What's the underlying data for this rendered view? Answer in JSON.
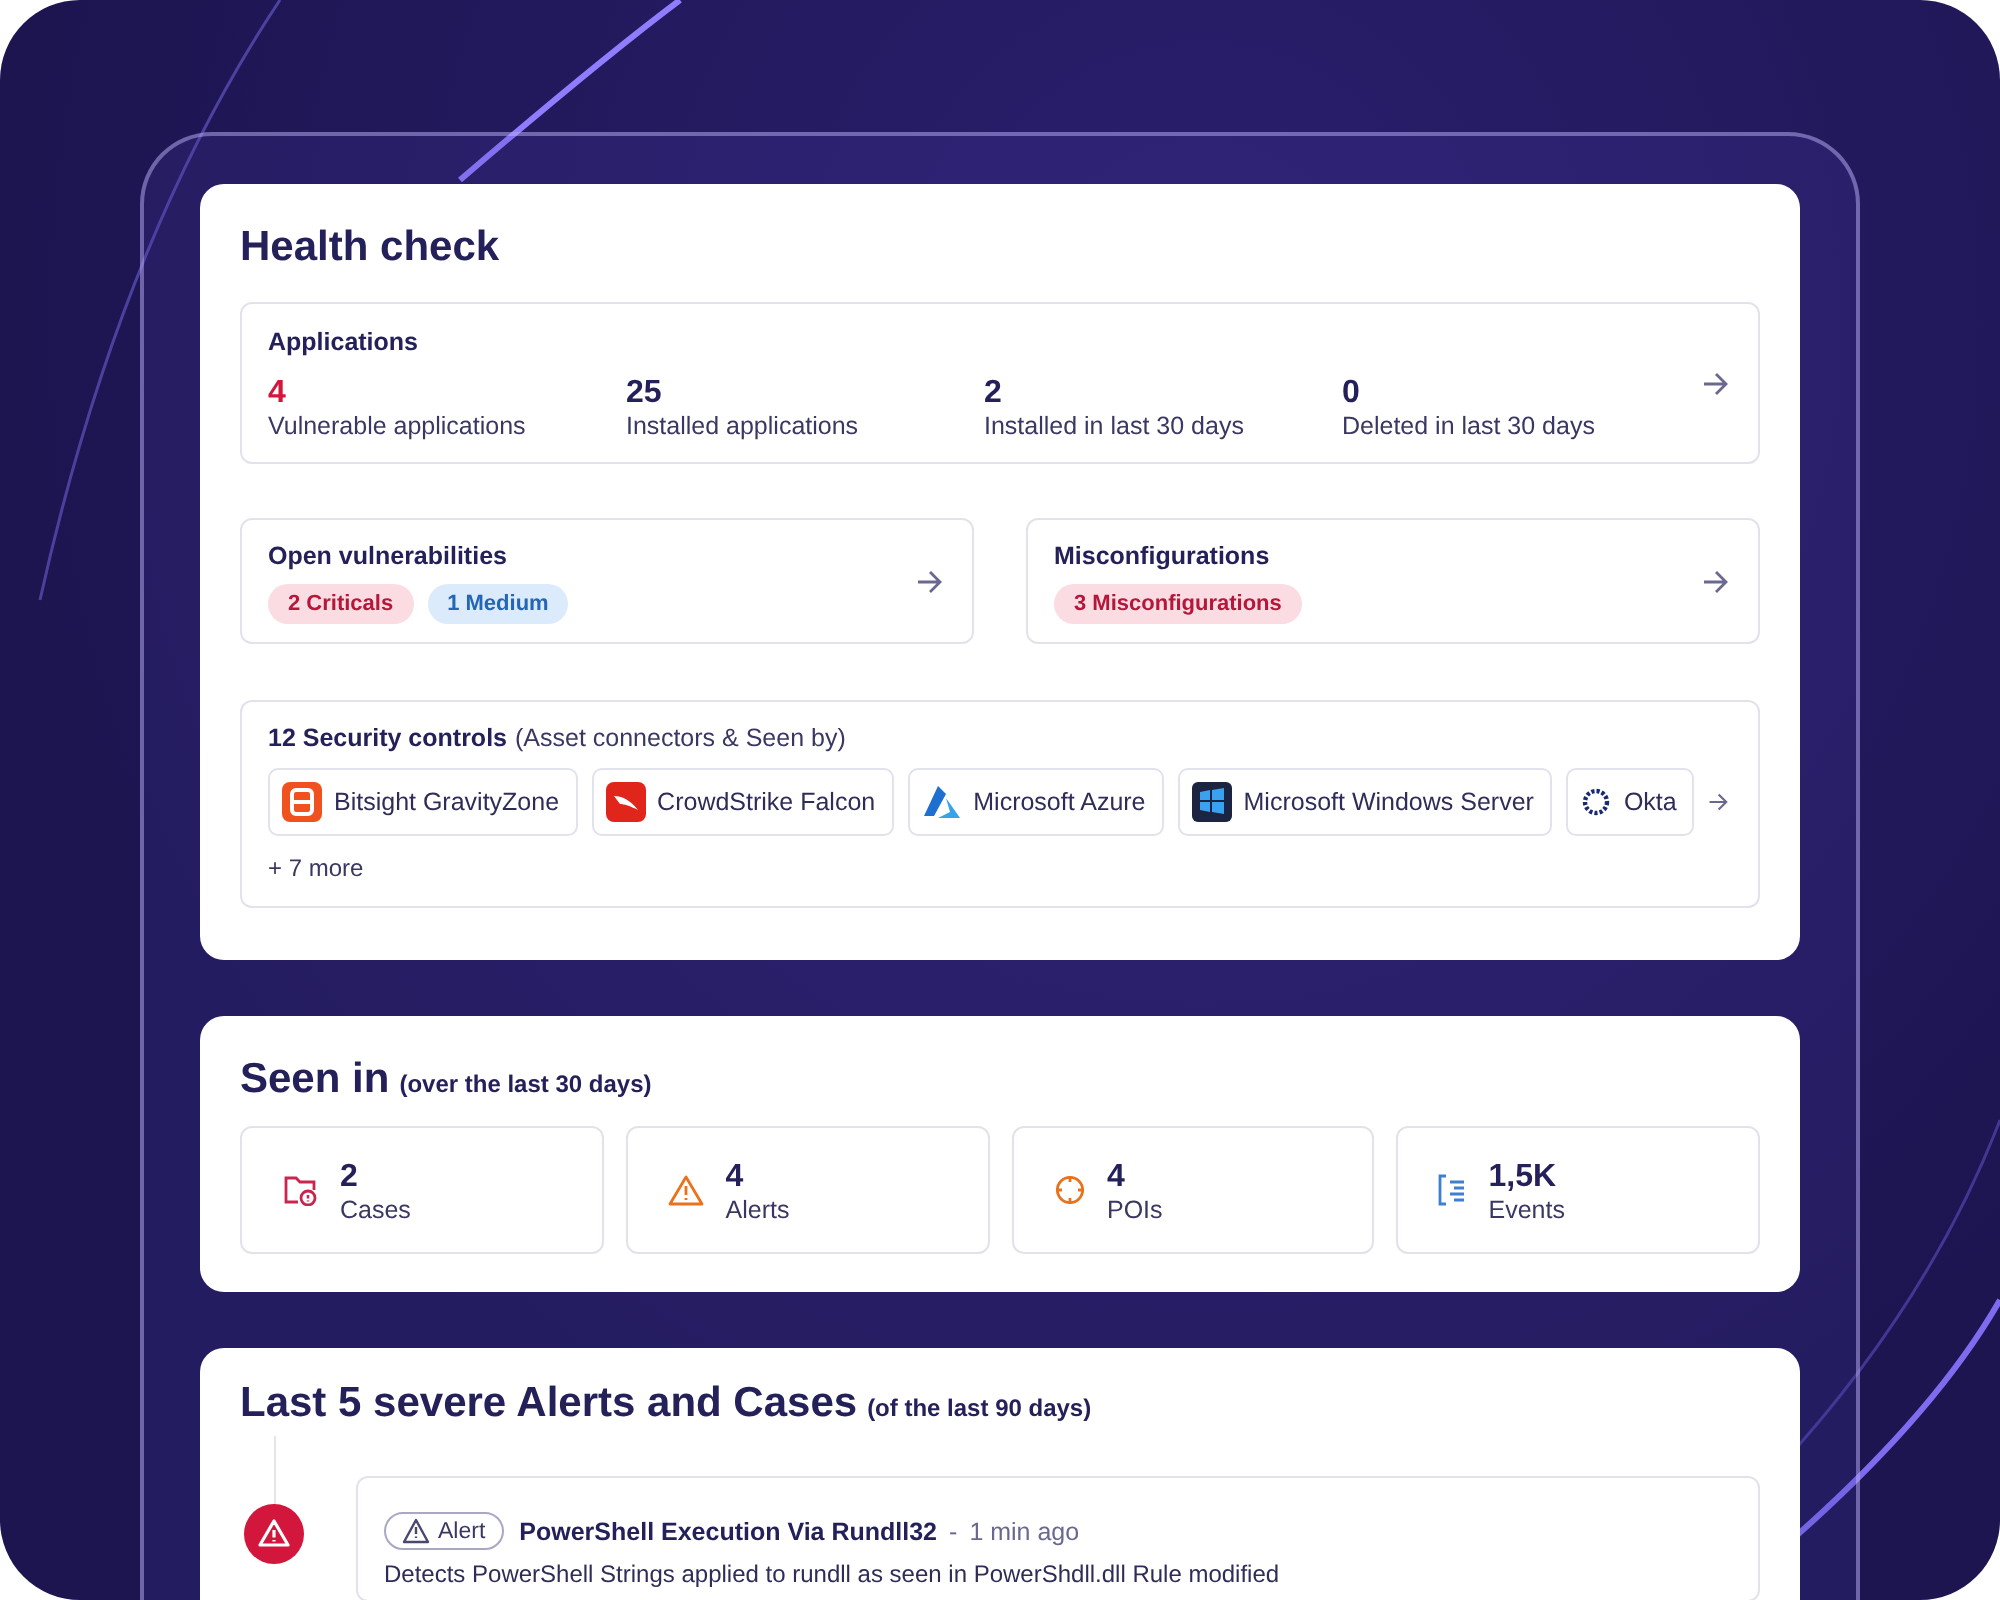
{
  "health_check": {
    "title": "Health check",
    "applications": {
      "title": "Applications",
      "stats": [
        {
          "value": "4",
          "label": "Vulnerable applications",
          "color": "#d3163c"
        },
        {
          "value": "25",
          "label": "Installed applications",
          "color": "#24215a"
        },
        {
          "value": "2",
          "label": "Installed in last 30 days",
          "color": "#24215a"
        },
        {
          "value": "0",
          "label": "Deleted in last 30 days",
          "color": "#24215a"
        }
      ]
    },
    "findings": [
      {
        "title": "Open vulnerabilities",
        "badges": [
          {
            "label": "2 Criticals",
            "kind": "critical"
          },
          {
            "label": "1 Medium",
            "kind": "medium"
          }
        ]
      },
      {
        "title": "Misconfigurations",
        "badges": [
          {
            "label": "3 Misconfigurations",
            "kind": "critical"
          }
        ]
      }
    ],
    "security_controls": {
      "title": "12 Security controls",
      "subtitle": "(Asset connectors & Seen by)",
      "connectors": [
        {
          "label": "Bitsight GravityZone",
          "kind": "bitsight"
        },
        {
          "label": "CrowdStrike Falcon",
          "kind": "crowdstrike"
        },
        {
          "label": "Microsoft Azure",
          "kind": "azure"
        },
        {
          "label": "Microsoft Windows Server",
          "kind": "windows"
        },
        {
          "label": "Okta",
          "kind": "okta"
        }
      ],
      "more": "+ 7 more"
    }
  },
  "seen_in": {
    "title": "Seen in",
    "subtitle": "(over the last 30 days)",
    "stats": [
      {
        "value": "2",
        "label": "Cases",
        "kind": "cases"
      },
      {
        "value": "4",
        "label": "Alerts",
        "kind": "alerts"
      },
      {
        "value": "4",
        "label": "POIs",
        "kind": "pois"
      },
      {
        "value": "1,5K",
        "label": "Events",
        "kind": "events"
      }
    ]
  },
  "severe": {
    "title": "Last 5 severe Alerts and Cases",
    "subtitle": "(of the last 90 days)",
    "items": [
      {
        "type": "Alert",
        "kind": "critical",
        "title": "PowerShell Execution Via Rundll32",
        "separator": "-",
        "time": "1 min ago",
        "description": "Detects PowerShell Strings applied to rundll as seen in PowerShdll.dll Rule modified"
      }
    ]
  }
}
